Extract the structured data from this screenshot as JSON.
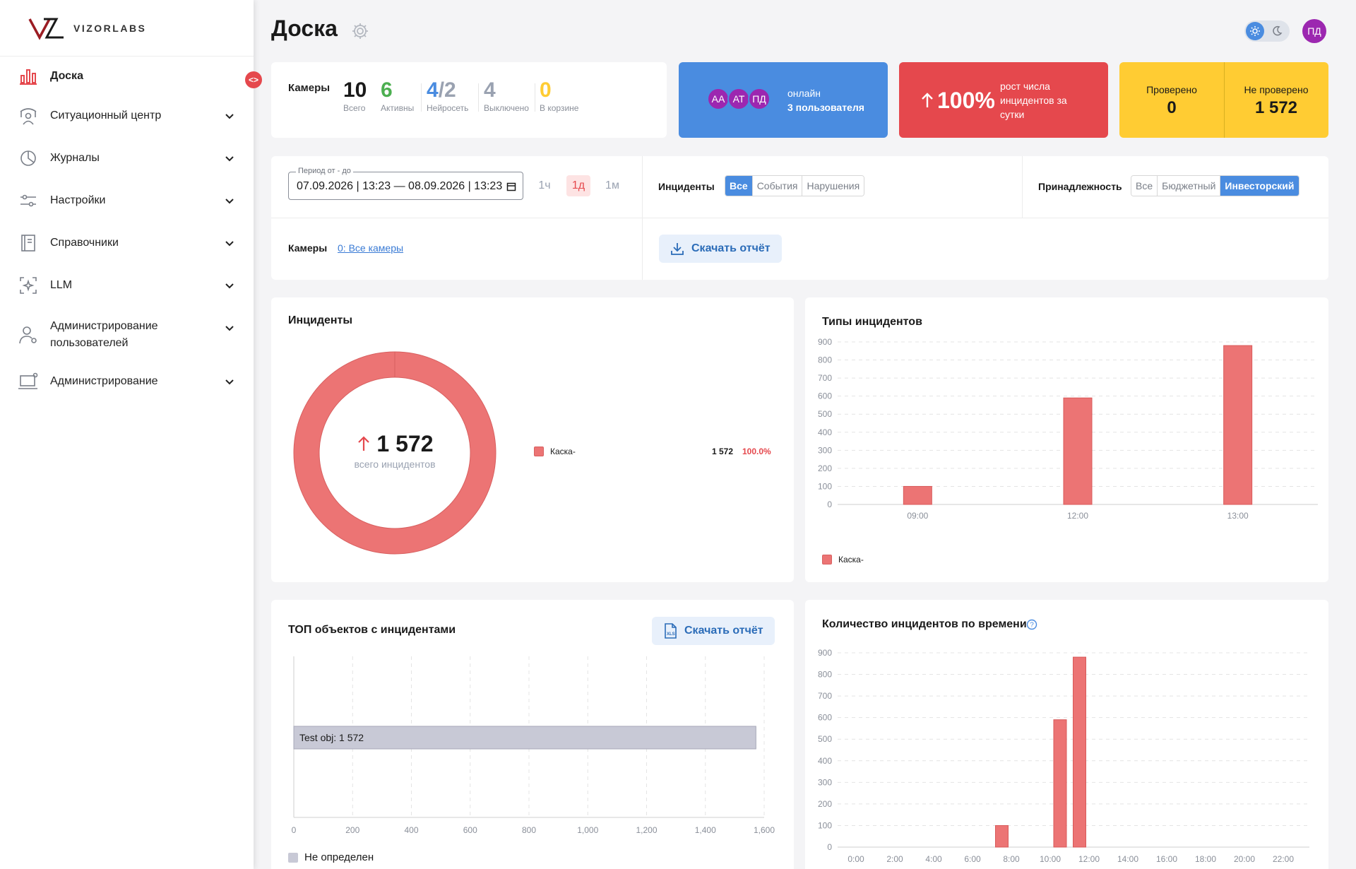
{
  "brand": {
    "name": "VIZORLABS"
  },
  "sidebar": {
    "items": [
      {
        "label": "Доска",
        "icon": "bar-chart-icon",
        "active": true
      },
      {
        "label": "Ситуационный центр",
        "icon": "situation-center-icon"
      },
      {
        "label": "Журналы",
        "icon": "pie-chart-icon"
      },
      {
        "label": "Настройки",
        "icon": "sliders-icon"
      },
      {
        "label": "Справочники",
        "icon": "book-icon"
      },
      {
        "label": "LLM",
        "icon": "llm-icon"
      },
      {
        "label": "Администрирование пользователей",
        "icon": "user-gear-icon"
      },
      {
        "label": "Администрирование",
        "icon": "laptop-gear-icon"
      }
    ],
    "collapse_label": "<>"
  },
  "header": {
    "title": "Доска",
    "user_initials": "ПД"
  },
  "cameras": {
    "title": "Камеры",
    "stats": [
      {
        "value": "10",
        "caption": "Всего",
        "color": "#1a1a1a"
      },
      {
        "value": "6",
        "caption": "Активны",
        "color": "#4caf50"
      },
      {
        "value": "4",
        "value_b": "/2",
        "caption": "Нейросеть",
        "color": "#4a8ce0"
      },
      {
        "value": "4",
        "caption": "Выключено",
        "color": "#9aa2b1"
      },
      {
        "value": "0",
        "caption": "В корзине",
        "color": "#ffcc33"
      }
    ]
  },
  "online": {
    "avatars": [
      "АА",
      "АТ",
      "ПД"
    ],
    "line1": "онлайн",
    "line2": "3 пользователя"
  },
  "growth": {
    "value": "100%",
    "text": "рост числа инцидентов за сутки"
  },
  "checked": {
    "checked_label": "Проверено",
    "checked_value": "0",
    "unchecked_label": "Не проверено",
    "unchecked_value": "1 572"
  },
  "filters": {
    "period_label": "Период от - до",
    "period_value": "07.09.2026 | 13:23 — 08.09.2026 | 13:23",
    "ranges": [
      {
        "label": "1ч",
        "active": false
      },
      {
        "label": "1д",
        "active": true
      },
      {
        "label": "1м",
        "active": false
      }
    ],
    "incidents_label": "Инциденты",
    "incidents_options": [
      {
        "label": "Все",
        "active": true
      },
      {
        "label": "События",
        "active": false
      },
      {
        "label": "Нарушения",
        "active": false
      }
    ],
    "belong_label": "Принадлежность",
    "belong_options": [
      {
        "label": "Все",
        "active": false
      },
      {
        "label": "Бюджетный",
        "active": false
      },
      {
        "label": "Инвесторский",
        "active": true
      }
    ],
    "cameras_label": "Камеры",
    "cameras_link": "0: Все камеры",
    "download_label": "Скачать отчёт"
  },
  "incidents_card": {
    "title": "Инциденты",
    "total": "1 572",
    "total_caption": "всего инцидентов",
    "legend": [
      {
        "name": "Каска-",
        "count": "1 572",
        "percent": "100.0%",
        "color": "#ec7474"
      }
    ]
  },
  "types_card": {
    "title": "Типы инцидентов",
    "legend": "Каска-"
  },
  "top_card": {
    "title": "ТОП объектов с инцидентами",
    "download_label": "Скачать отчёт",
    "legend": "Не определен"
  },
  "time_card": {
    "title": "Количество инцидентов по времени"
  },
  "chart_data": [
    {
      "type": "pie",
      "title": "Инциденты",
      "categories": [
        "Каска-"
      ],
      "values": [
        1572
      ],
      "colors": [
        "#ec7474"
      ]
    },
    {
      "type": "bar",
      "title": "Типы инцидентов",
      "categories": [
        "09:00",
        "12:00",
        "13:00"
      ],
      "series": [
        {
          "name": "Каска-",
          "values": [
            100,
            590,
            880
          ]
        }
      ],
      "ylim": [
        0,
        900
      ],
      "yticks": [
        0,
        100,
        200,
        300,
        400,
        500,
        600,
        700,
        800,
        900
      ],
      "color": "#ec7474"
    },
    {
      "type": "bar",
      "title": "ТОП объектов с инцидентами",
      "orientation": "horizontal",
      "categories": [
        "Test obj"
      ],
      "values": [
        1572
      ],
      "bar_label": "Test obj: 1 572",
      "xlim": [
        0,
        1600
      ],
      "xticks": [
        "0",
        "200",
        "400",
        "600",
        "800",
        "1,000",
        "1,200",
        "1,400",
        "1,600"
      ],
      "series": [
        {
          "name": "Не определен",
          "values": [
            1572
          ]
        }
      ],
      "color": "#c8c9d6"
    },
    {
      "type": "bar",
      "title": "Количество инцидентов по времени",
      "x": [
        7.0,
        10.0,
        11.0
      ],
      "values": [
        100,
        590,
        880
      ],
      "xlim": [
        0,
        23
      ],
      "xticks": [
        "0:00",
        "2:00",
        "4:00",
        "6:00",
        "8:00",
        "10:00",
        "12:00",
        "14:00",
        "16:00",
        "18:00",
        "20:00",
        "22:00"
      ],
      "ylim": [
        0,
        900
      ],
      "yticks": [
        0,
        100,
        200,
        300,
        400,
        500,
        600,
        700,
        800,
        900
      ],
      "color": "#ec7474"
    }
  ]
}
